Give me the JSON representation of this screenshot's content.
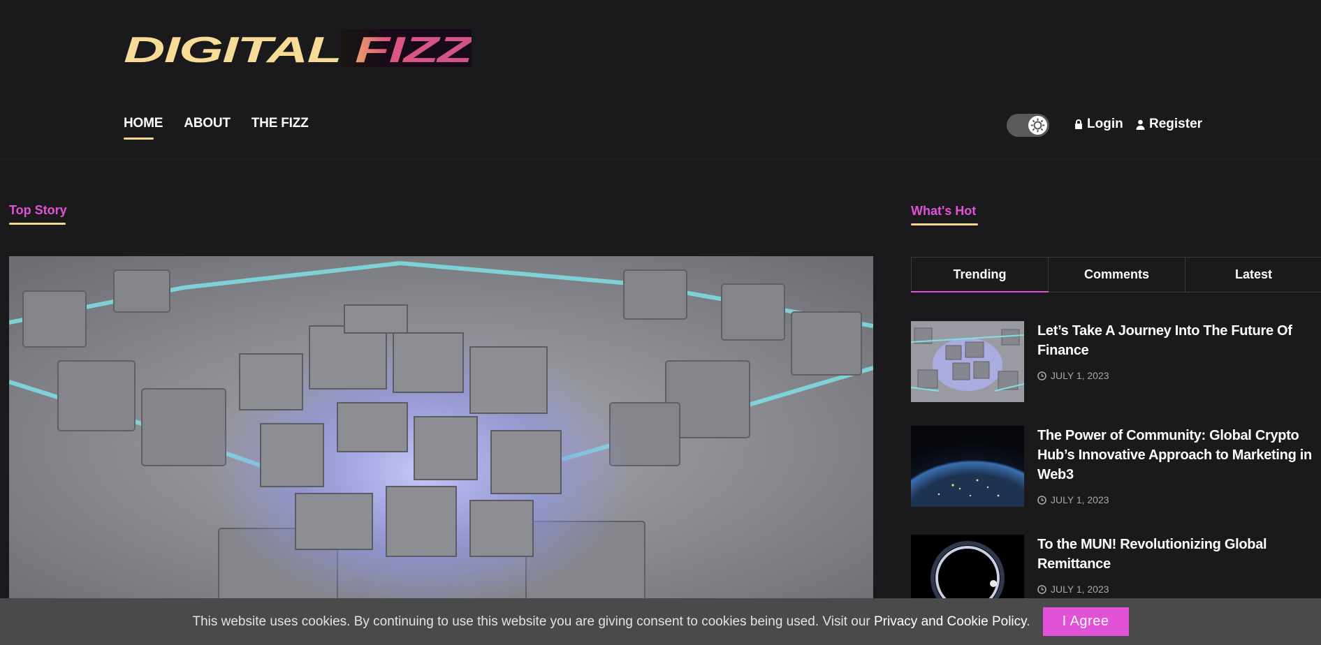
{
  "brand": {
    "logo_text": "DIGITAL FIZZ",
    "colors": {
      "accent": "#e252d9",
      "gold": "#f3d98a",
      "bg": "#1a191b"
    }
  },
  "nav": {
    "items": [
      {
        "label": "HOME",
        "active": true
      },
      {
        "label": "ABOUT"
      },
      {
        "label": "THE FIZZ"
      }
    ]
  },
  "auth": {
    "login": "Login",
    "register": "Register"
  },
  "top_story": {
    "heading": "Top Story"
  },
  "whats_hot": {
    "heading": "What's Hot",
    "tabs": [
      {
        "label": "Trending",
        "active": true
      },
      {
        "label": "Comments"
      },
      {
        "label": "Latest"
      }
    ],
    "stories": [
      {
        "title": "Let’s Take A Journey Into The Future Of Finance",
        "date": "JULY 1, 2023"
      },
      {
        "title": "The Power of Community: Global Crypto Hub’s Innovative Approach to Marketing in Web3",
        "date": "JULY 1, 2023"
      },
      {
        "title": "To the MUN! Revolutionizing Global Remittance",
        "date": "JULY 1, 2023"
      }
    ]
  },
  "cookie": {
    "message": "This website uses cookies. By continuing to use this website you are giving consent to cookies being used. Visit our ",
    "link": "Privacy and Cookie Policy",
    "period": ".",
    "button": "I Agree"
  }
}
